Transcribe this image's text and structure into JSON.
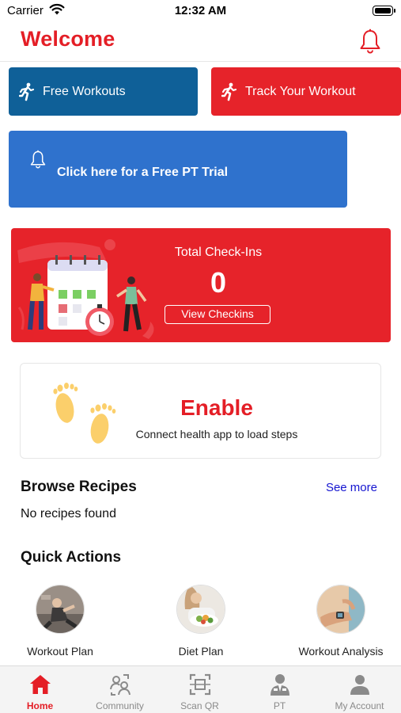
{
  "status_bar": {
    "carrier": "Carrier",
    "time": "12:32 AM"
  },
  "header": {
    "title": "Welcome"
  },
  "buttons": {
    "free_workouts": "Free Workouts",
    "track_workout": "Track Your Workout",
    "pt_trial": "Click here for a Free PT Trial"
  },
  "checkins": {
    "title": "Total Check-Ins",
    "count": "0",
    "view_button": "View Checkins"
  },
  "steps_card": {
    "enable": "Enable",
    "subtitle": "Connect health app to load steps"
  },
  "recipes": {
    "title": "Browse Recipes",
    "see_more": "See more",
    "empty": "No recipes found"
  },
  "quick_actions": {
    "title": "Quick Actions",
    "items": [
      {
        "label": "Workout Plan"
      },
      {
        "label": "Diet Plan"
      },
      {
        "label": "Workout Analysis"
      }
    ]
  },
  "tabbar": {
    "active": "Home",
    "items": [
      {
        "label": "Home",
        "icon": "home-icon"
      },
      {
        "label": "Community",
        "icon": "community-icon"
      },
      {
        "label": "Scan QR",
        "icon": "scan-qr-icon"
      },
      {
        "label": "PT",
        "icon": "trainer-icon"
      },
      {
        "label": "My Account",
        "icon": "account-icon"
      }
    ]
  },
  "colors": {
    "brand_red": "#e41e26",
    "free_workouts_blue": "#0f6098",
    "pt_trial_blue": "#2f72cd",
    "link_blue": "#1515d0"
  }
}
